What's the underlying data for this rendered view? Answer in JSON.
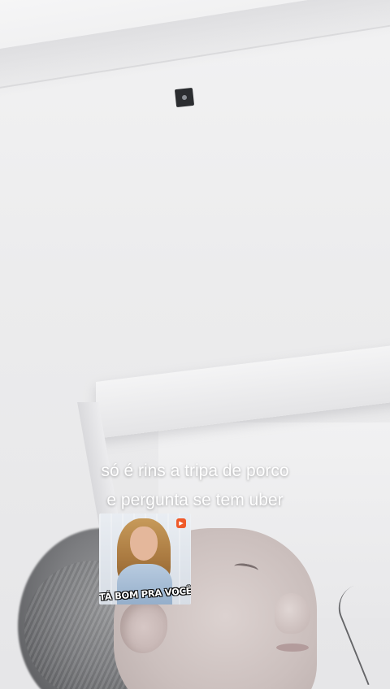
{
  "caption": {
    "line1": "só é rins a tripa de porco",
    "line2": "e pergunta se tem uber"
  },
  "sticker": {
    "text": "TÁ BOM PRA VOCÊ?",
    "logo_icon": "app-logo-icon",
    "logo_color": "#ef5a2a"
  },
  "scene": {
    "wall_color": "#ececed",
    "sensor_icon": "ceiling-sensor-icon"
  }
}
